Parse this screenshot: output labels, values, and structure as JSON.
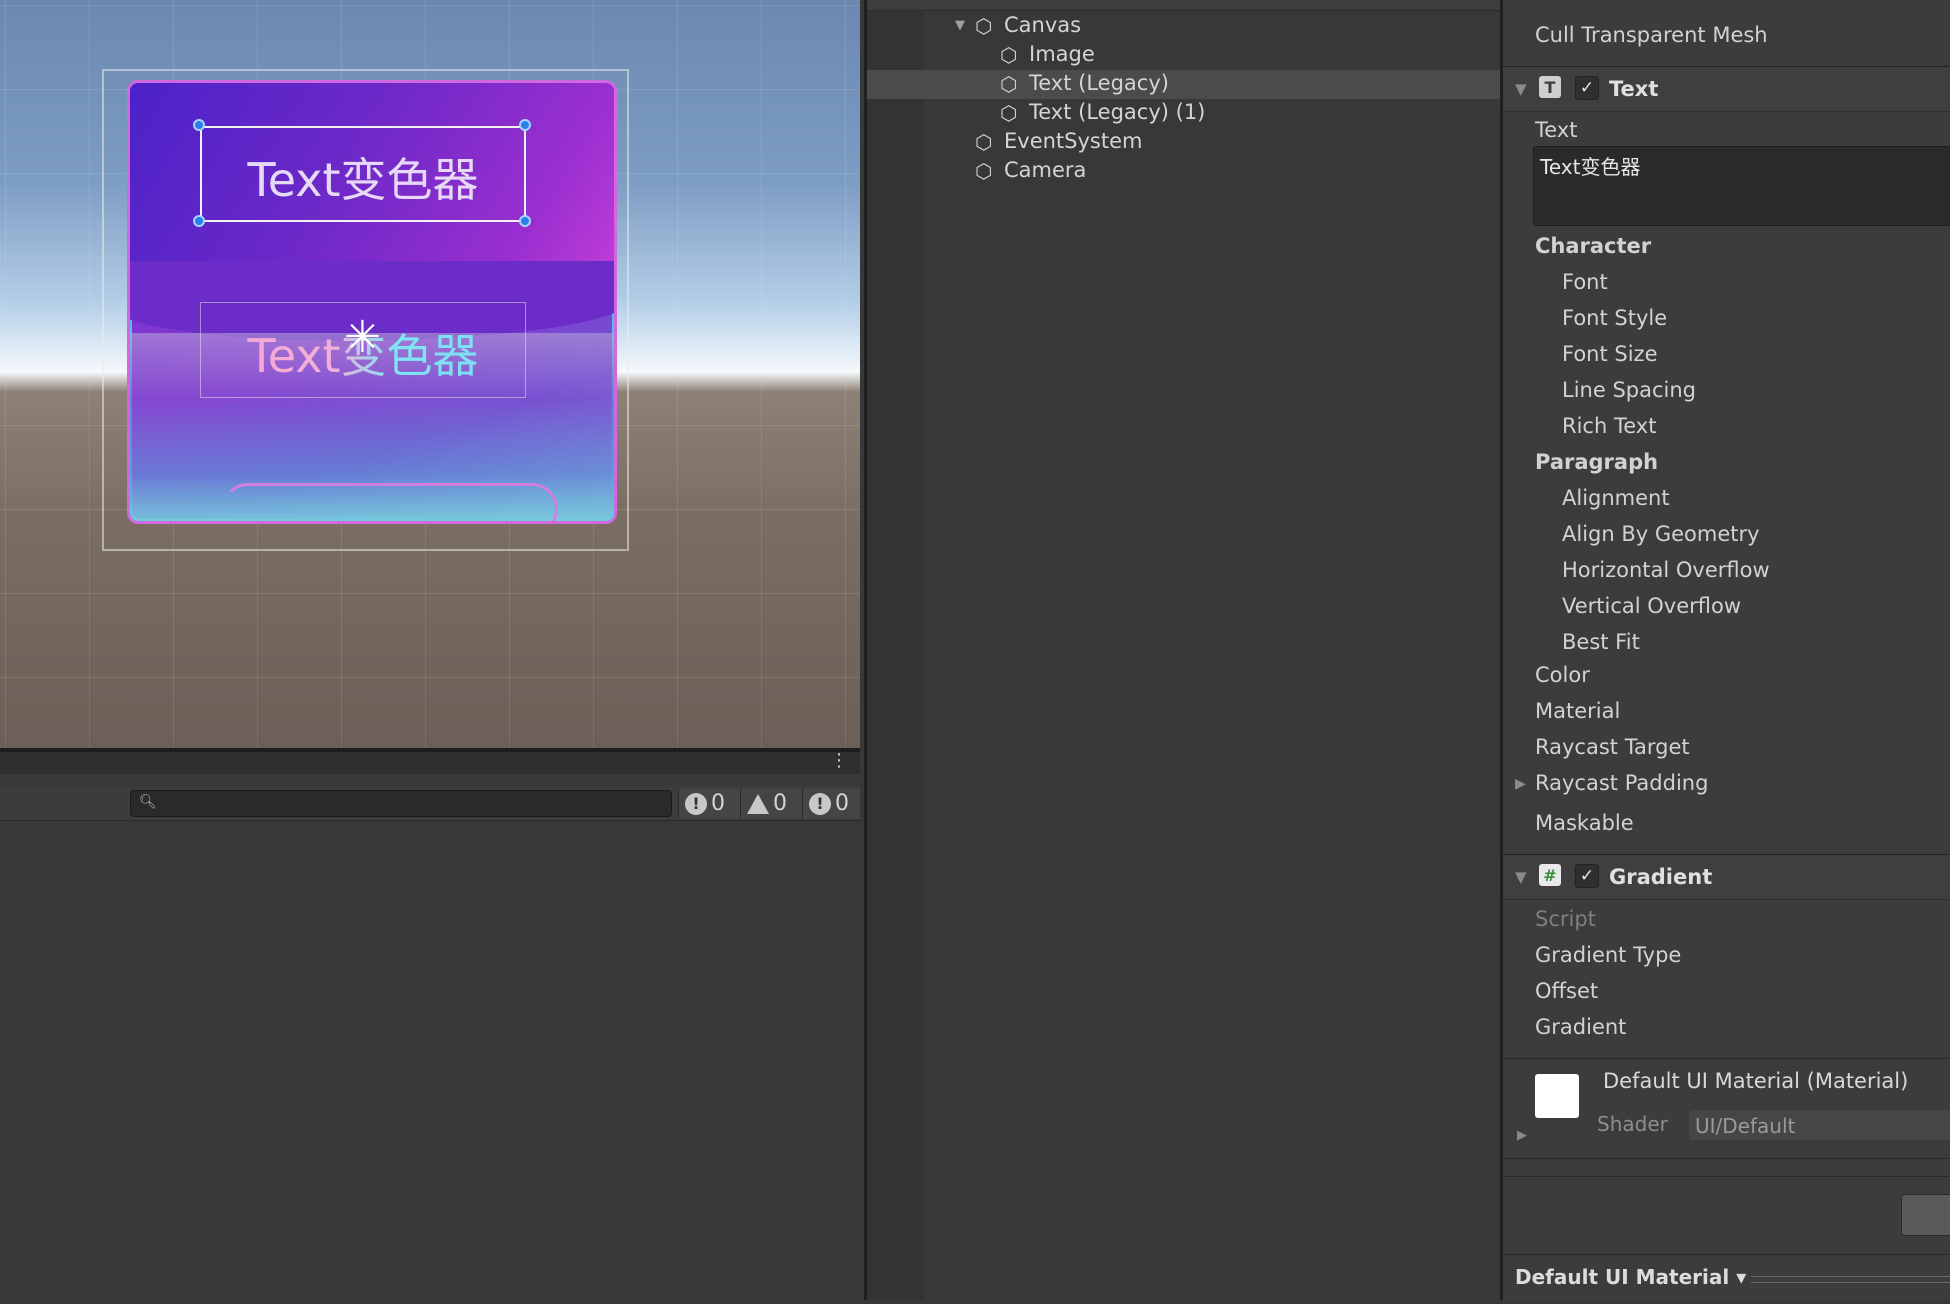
{
  "scene": {
    "text_label_1": "Text变色器",
    "text_label_2": "Text变色器"
  },
  "console": {
    "search_placeholder": "",
    "log_count": "0",
    "warning_count": "0",
    "error_count": "0",
    "menu_glyph": "⋮"
  },
  "hierarchy": {
    "items": [
      {
        "label": "Canvas",
        "indent": 1,
        "expanded": true
      },
      {
        "label": "Image",
        "indent": 2
      },
      {
        "label": "Text (Legacy)",
        "indent": 2,
        "selected": true
      },
      {
        "label": "Text (Legacy) (1)",
        "indent": 2
      },
      {
        "label": "EventSystem",
        "indent": 1
      },
      {
        "label": "Camera",
        "indent": 1
      }
    ]
  },
  "inspector": {
    "cull_label": "Cull Transparent Mesh",
    "text_component": {
      "title": "Text",
      "text_label": "Text",
      "text_value": "Text变色器",
      "character_header": "Character",
      "font": "Font",
      "font_style": "Font Style",
      "font_size": "Font Size",
      "line_spacing": "Line Spacing",
      "rich_text": "Rich Text",
      "paragraph_header": "Paragraph",
      "alignment": "Alignment",
      "align_by_geometry": "Align By Geometry",
      "horizontal_overflow": "Horizontal Overflow",
      "vertical_overflow": "Vertical Overflow",
      "best_fit": "Best Fit",
      "color": "Color",
      "material": "Material",
      "raycast_target": "Raycast Target",
      "raycast_padding": "Raycast Padding",
      "maskable": "Maskable"
    },
    "gradient_component": {
      "title": "Gradient",
      "script": "Script",
      "gradient_type": "Gradient Type",
      "offset": "Offset",
      "gradient": "Gradient"
    },
    "material_block": {
      "name": "Default UI Material (Material)",
      "shader_label": "Shader",
      "shader_value": "UI/Default"
    },
    "bottom_dropdown": "Default UI Material"
  },
  "colors": {
    "selection_handle": "#2c7ee8",
    "panel_bg": "#383838",
    "inspector_bg": "#3c3c3c"
  }
}
